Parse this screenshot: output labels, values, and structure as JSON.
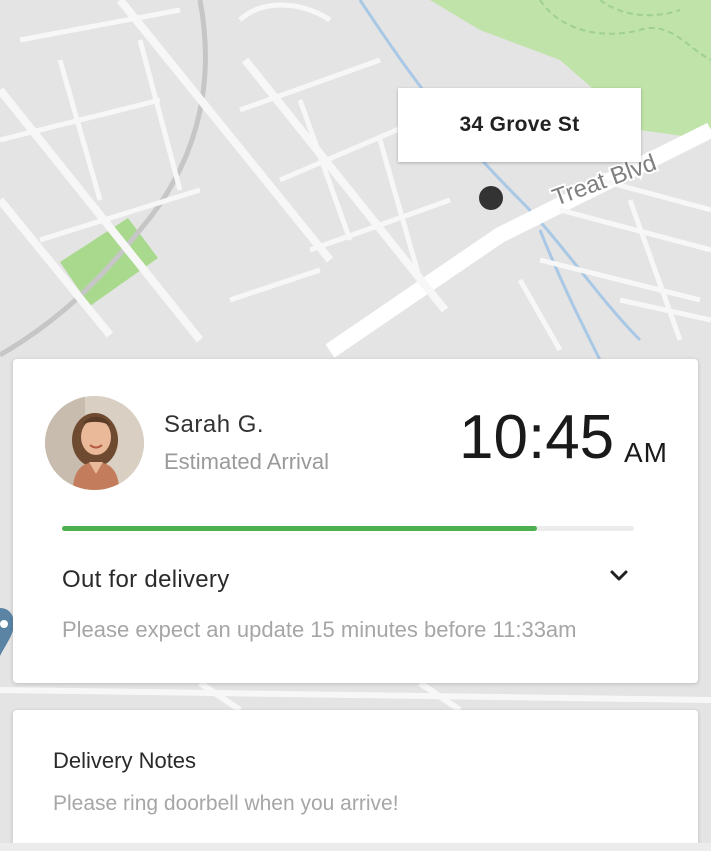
{
  "map": {
    "street_label": "Treat Blvd",
    "destination_address": "34 Grove St"
  },
  "courier": {
    "name": "Sarah G.",
    "eta_label": "Estimated Arrival",
    "eta_time": "10:45",
    "eta_period": "AM"
  },
  "progress": {
    "fraction": 0.83,
    "color": "#4caf50"
  },
  "status": {
    "text": "Out for delivery",
    "update_message": "Please expect an update 15 minutes before 11:33am"
  },
  "delivery_notes": {
    "title": "Delivery Notes",
    "text": "Please ring doorbell when you arrive!"
  }
}
